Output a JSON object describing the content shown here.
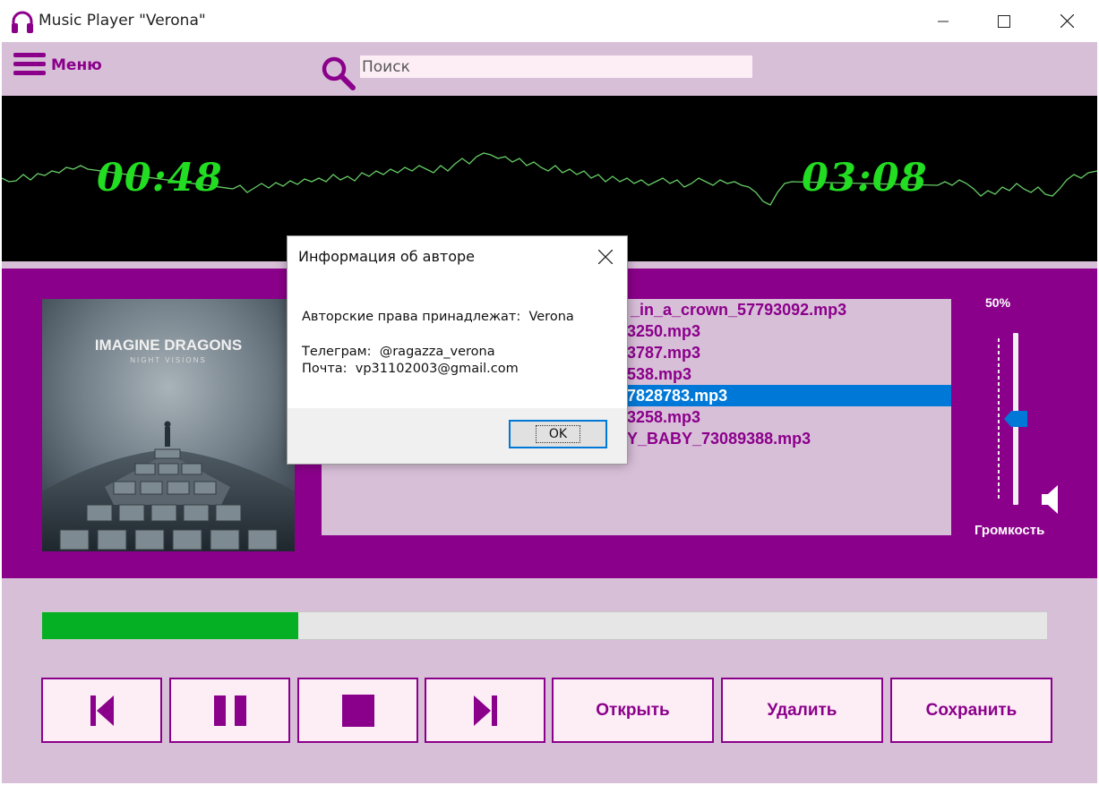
{
  "window": {
    "title": "Music Player \"Verona\"",
    "controls": [
      "minimize-icon",
      "maximize-icon",
      "close-icon"
    ]
  },
  "menu": {
    "label": "Меню",
    "icon": "hamburger-icon"
  },
  "search": {
    "placeholder": "Поиск",
    "value": "",
    "icon": "search-icon"
  },
  "visualizer": {
    "current_time": "00:48",
    "total_time": "03:08",
    "wave_color": "#22dd22"
  },
  "album": {
    "title": "IMAGINE DRAGONS",
    "subtitle": "NIGHT VISIONS"
  },
  "playlist": {
    "items": [
      "_in_a_crown_57793092.mp3",
      "3250.mp3",
      "3787.mp3",
      "538.mp3",
      "7828783.mp3",
      "3258.mp3",
      "Y_BABY_73089388.mp3"
    ],
    "selected_index": 4
  },
  "volume": {
    "percent": "50%",
    "label": "Громкость",
    "level": 0.5
  },
  "progress": {
    "fraction": 0.255
  },
  "controls": {
    "prev_icon": "skip-back-icon",
    "pause_icon": "pause-icon",
    "stop_icon": "stop-icon",
    "next_icon": "skip-forward-icon",
    "open_label": "Открыть",
    "delete_label": "Удалить",
    "save_label": "Сохранить"
  },
  "dialog": {
    "title": "Информация об авторе",
    "copyright": "Авторские права принадлежат:  Verona",
    "telegram": "Телеграм:  @ragazza_verona",
    "email": "Почта:  vp31102003@gmail.com",
    "ok_label": "OK"
  },
  "colors": {
    "accent": "#8b008b",
    "panel_bg": "#d8bfd8",
    "progress_fill": "#06b025",
    "selection": "#0078d7"
  }
}
